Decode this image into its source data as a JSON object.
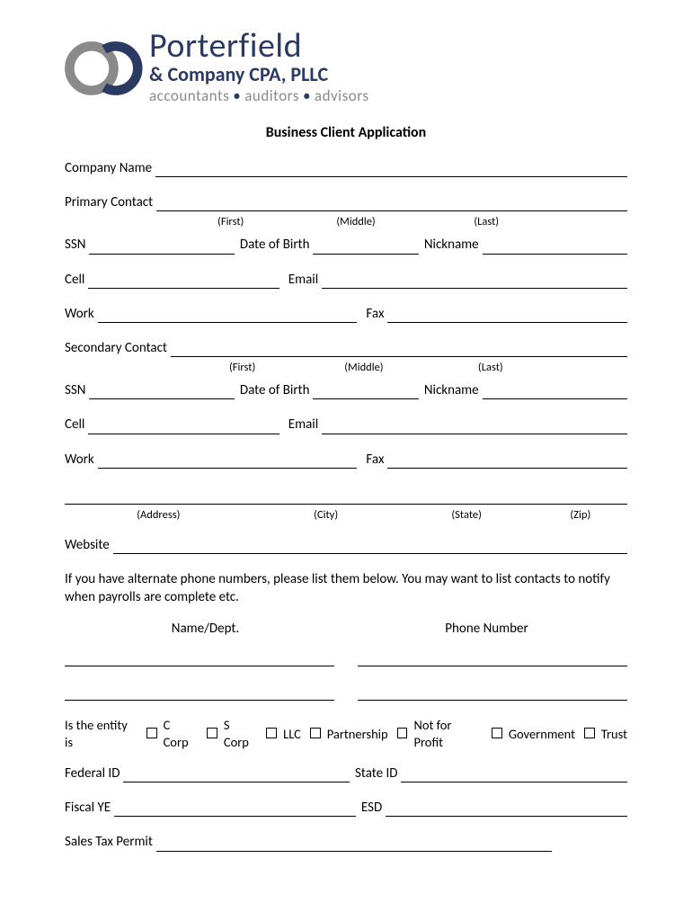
{
  "logo": {
    "name_top": "Porterfield",
    "name_mid": "& Company CPA, PLLC",
    "tag_a": "accountants",
    "tag_b": "auditors",
    "tag_c": "advisors"
  },
  "title": "Business Client Application",
  "labels": {
    "company_name": "Company Name",
    "primary_contact": "Primary Contact",
    "secondary_contact": "Secondary Contact",
    "first": "(First)",
    "middle": "(Middle)",
    "last": "(Last)",
    "ssn": "SSN",
    "dob": "Date of Birth",
    "nickname": "Nickname",
    "cell": "Cell",
    "email": "Email",
    "work": "Work",
    "fax": "Fax",
    "address": "(Address)",
    "city": "(City)",
    "state": "(State)",
    "zip": "(Zip)",
    "website": "Website",
    "alt_note": "If you have alternate phone numbers, please list them below.  You may want to list contacts to notify when payrolls are complete etc.",
    "name_dept": "Name/Dept.",
    "phone_number": "Phone Number",
    "entity_q": "Is the entity is",
    "federal_id": "Federal ID",
    "state_id": "State ID",
    "fiscal_ye": "Fiscal YE",
    "esd": "ESD",
    "sales_tax": "Sales Tax Permit"
  },
  "entity_options": [
    "C Corp",
    "S Corp",
    "LLC",
    "Partnership",
    "Not for Profit",
    "Government",
    "Trust"
  ]
}
